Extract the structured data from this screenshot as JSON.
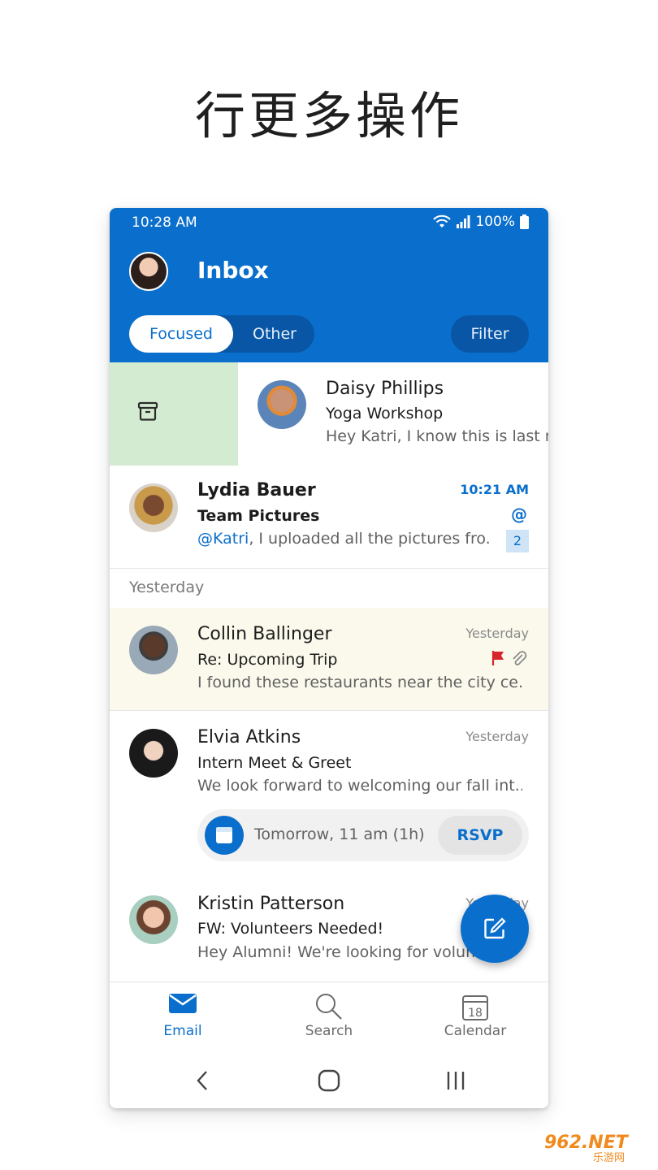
{
  "headline": "行更多操作",
  "status": {
    "time": "10:28 AM",
    "battery": "100%"
  },
  "header": {
    "title": "Inbox",
    "tab_focused": "Focused",
    "tab_other": "Other",
    "filter": "Filter"
  },
  "messages": [
    {
      "sender": "Daisy Phillips",
      "subject": "Yoga Workshop",
      "preview": "Hey Katri, I know this is last m",
      "time": ""
    },
    {
      "sender": "Lydia Bauer",
      "subject": "Team Pictures",
      "mention": "@Katri",
      "preview": ", I uploaded all the pictures fro...",
      "time": "10:21 AM",
      "at_badge": "@",
      "count": "2"
    },
    {
      "sender": "Collin Ballinger",
      "subject": "Re: Upcoming Trip",
      "preview": "I found these restaurants near the city ce...",
      "time": "Yesterday"
    },
    {
      "sender": "Elvia Atkins",
      "subject": "Intern Meet & Greet",
      "preview": "We look forward to welcoming our fall int...",
      "time": "Yesterday"
    },
    {
      "sender": "Kristin Patterson",
      "subject": "FW: Volunteers Needed!",
      "preview": "Hey Alumni! We're looking for volunte",
      "time": "Yesterday"
    }
  ],
  "section_yesterday": "Yesterday",
  "rsvp": {
    "when": "Tomorrow, 11 am (1h)",
    "button": "RSVP"
  },
  "nav": {
    "email": "Email",
    "search": "Search",
    "calendar": "Calendar",
    "calendar_day": "18"
  },
  "watermark": {
    "main": "962.NET",
    "sub": "乐游网"
  },
  "colors": {
    "accent": "#0a6fcc",
    "swipe_archive": "#d3ebd0",
    "flagged_row": "#fbf9ec",
    "flag": "#d7262b"
  }
}
